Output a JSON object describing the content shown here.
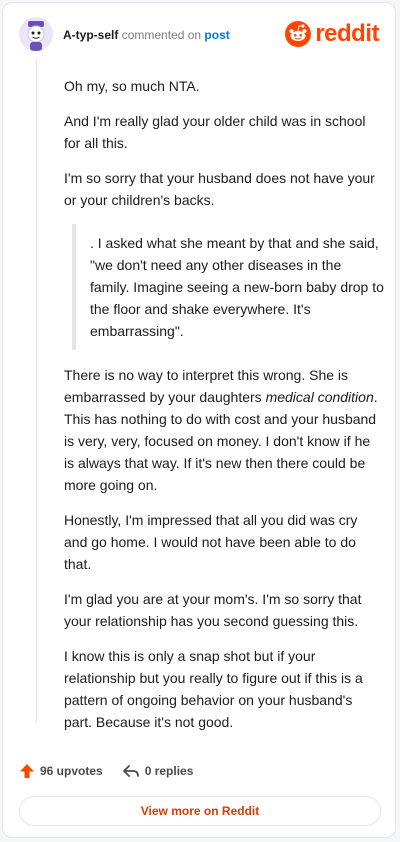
{
  "header": {
    "username": "A-typ-self",
    "action_text": "commented on",
    "post_link": "post",
    "logo_text": "reddit"
  },
  "comment": {
    "paragraphs_before": [
      "Oh my, so much NTA.",
      "And I'm really glad your older child was in school for all this.",
      "I'm so sorry that your husband does not have your or your children's backs."
    ],
    "quote": ". I asked what she meant by that and she said, \"we don't need any other diseases in the family. Imagine seeing a new-born baby drop to the floor and shake everywhere. It's embarrassing\".",
    "paragraph_emphasis": {
      "before": "There is no way to interpret this wrong. She is embarrassed by your daughters ",
      "em": "medical condition",
      "after": ". This has nothing to do with cost and your husband is very, very, focused on money. I don't know if he is always that way. If it's new then there could be more going on."
    },
    "paragraphs_after": [
      "Honestly, I'm impressed that all you did was cry and go home. I would not have been able to do that.",
      "I'm glad you are at your mom's. I'm so sorry that your relationship has you second guessing this.",
      "I know this is only a snap shot but if your relationship but you really to figure out if this is a pattern of ongoing behavior on your husband's part. Because it's not good."
    ]
  },
  "footer": {
    "upvotes": "96 upvotes",
    "replies": "0 replies",
    "view_more": "View more on Reddit"
  },
  "colors": {
    "brand": "#ff4500",
    "link": "#0079d3",
    "upvote": "#ff4500",
    "view_more": "#d93a00"
  },
  "icons": {
    "avatar": "snoo-avatar",
    "logo": "reddit-snoo-logo",
    "upvote": "upvote-arrow-icon",
    "reply": "reply-arrow-icon"
  }
}
